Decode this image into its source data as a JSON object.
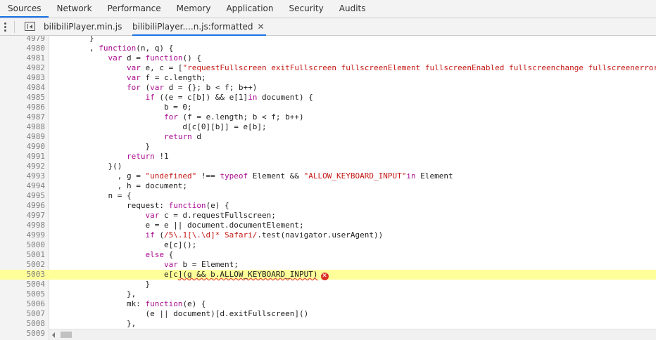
{
  "panel_tabs": [
    "Sources",
    "Network",
    "Performance",
    "Memory",
    "Application",
    "Security",
    "Audits"
  ],
  "active_panel": "Sources",
  "file_tabs": {
    "file1": "bilibiliPlayer.min.js",
    "file2": "bilibiliPlayer....n.js:formatted",
    "close": "✕"
  },
  "error_icon": "✕",
  "colors": {
    "accent": "#1a73e8",
    "highlight": "#ffff99",
    "error": "#d93025",
    "keyword": "#aa0d91",
    "string": "#c41a16"
  },
  "lines": [
    {
      "n": "4979",
      "t": "        }"
    },
    {
      "n": "4980",
      "t": "        , function(n, q) {"
    },
    {
      "n": "4981",
      "t": "            var d = function() {"
    },
    {
      "n": "4982",
      "t": "                var e, c = [\"requestFullscreen exitFullscreen fullscreenElement fullscreenEnabled fullscreenchange fullscreenerror\".spl"
    },
    {
      "n": "4983",
      "t": "                var f = c.length;"
    },
    {
      "n": "4984",
      "t": "                for (var d = {}; b < f; b++)"
    },
    {
      "n": "4985",
      "t": "                    if ((e = c[b]) && e[1]in document) {"
    },
    {
      "n": "4986",
      "t": "                        b = 0;"
    },
    {
      "n": "4987",
      "t": "                        for (f = e.length; b < f; b++)"
    },
    {
      "n": "4988",
      "t": "                            d[c[0][b]] = e[b];"
    },
    {
      "n": "4989",
      "t": "                        return d"
    },
    {
      "n": "4990",
      "t": "                    }"
    },
    {
      "n": "4991",
      "t": "                return !1"
    },
    {
      "n": "4992",
      "t": "            }()"
    },
    {
      "n": "4993",
      "t": "              , g = \"undefined\" !== typeof Element && \"ALLOW_KEYBOARD_INPUT\"in Element"
    },
    {
      "n": "4994",
      "t": "              , h = document;"
    },
    {
      "n": "4995",
      "t": "            n = {"
    },
    {
      "n": "4996",
      "t": "                request: function(e) {"
    },
    {
      "n": "4997",
      "t": "                    var c = d.requestFullscreen;"
    },
    {
      "n": "4998",
      "t": "                    e = e || document.documentElement;"
    },
    {
      "n": "4999",
      "t": "                    if (/5\\.1[\\.\\d]* Safari/.test(navigator.userAgent))"
    },
    {
      "n": "5000",
      "t": "                        e[c]();"
    },
    {
      "n": "5001",
      "t": "                    else {"
    },
    {
      "n": "5002",
      "t": "                        var b = Element;"
    },
    {
      "n": "5003",
      "t": "                        e[c](g && b.ALLOW_KEYBOARD_INPUT)"
    },
    {
      "n": "5004",
      "t": "                    }"
    },
    {
      "n": "5005",
      "t": "                },"
    },
    {
      "n": "5006",
      "t": "                mk: function(e) {"
    },
    {
      "n": "5007",
      "t": "                    (e || document)[d.exitFullscreen]()"
    },
    {
      "n": "5008",
      "t": "                },"
    },
    {
      "n": "5009",
      "t": ""
    }
  ]
}
